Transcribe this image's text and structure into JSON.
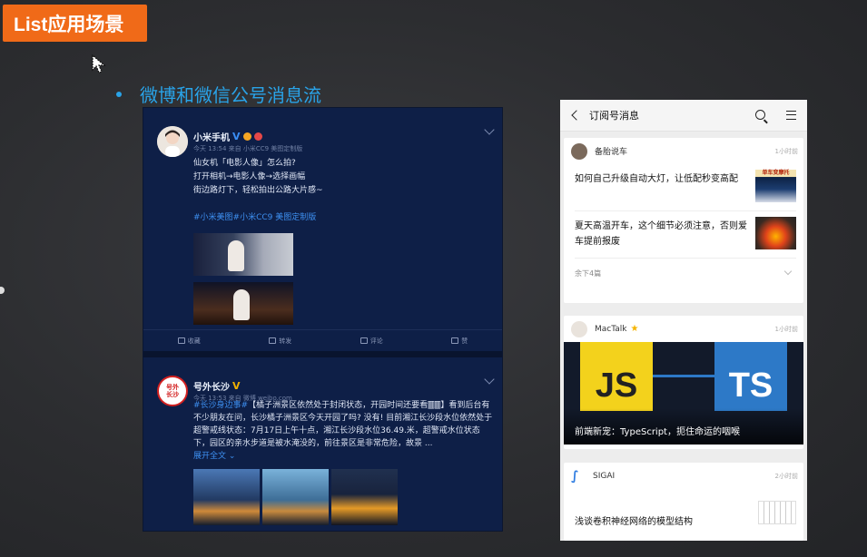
{
  "slide": {
    "title": "List应用场景",
    "bullet": "微博和微信公号消息流"
  },
  "weibo": {
    "post1": {
      "name": "小米手机",
      "verified": "V",
      "meta": "今天 13:54 来自 小米CC9 美图定制版",
      "lines": [
        "仙女机「电影人像」怎么拍?",
        "打开相机→电影人像→选择画幅",
        "街边路灯下，轻松拍出公路大片感~"
      ],
      "tags": "#小米美图#小米CC9 美图定制版",
      "actions": {
        "favorite": "收藏",
        "repost": "转发",
        "comment": "评论",
        "like": "赞"
      }
    },
    "post2": {
      "name": "号外长沙",
      "verified": "V",
      "avatar_text": "号外长沙",
      "meta": "今天 13:53 来自 微博 weibo.com",
      "tag": "#长沙身边事#",
      "text": "【橘子洲景区依然处于封闭状态，开园时间还要看🀫🀫】看到后台有不少朋友在问，长沙橘子洲景区今天开园了吗? 没有! 目前湘江长沙段水位依然处于超警戒线状态：7月17日上午十点，湘江长沙段水位36.49.米，超警戒水位状态下，园区的亲水步道是被水淹没的，前往景区是非常危险，故景 ...",
      "expand": "展开全文"
    }
  },
  "wechat": {
    "header_title": "订阅号消息",
    "cards": [
      {
        "source": "备胎说车",
        "time": "1小时前",
        "articles": [
          {
            "title": "如何自己升级自动大灯，让低配秒变高配",
            "thumb_text": "单车变摩托"
          },
          {
            "title": "夏天高温开车，这个细节必须注意，否则爱车提前报废"
          }
        ],
        "rest": "余下4篇"
      },
      {
        "source": "MacTalk",
        "time": "1小时前",
        "banner_left": "JS",
        "banner_right": "TS",
        "caption": "前端新宠：TypeScript，扼住命运的咽喉"
      },
      {
        "source": "SIGAI",
        "time": "2小时前",
        "article": "浅谈卷积神经网络的模型结构"
      }
    ]
  }
}
